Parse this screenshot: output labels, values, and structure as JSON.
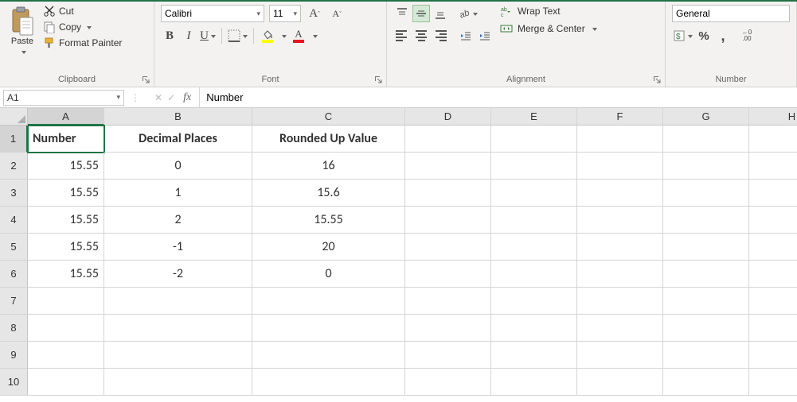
{
  "ribbon": {
    "clipboard": {
      "paste": "Paste",
      "cut": "Cut",
      "copy": "Copy",
      "format_painter": "Format Painter",
      "group_label": "Clipboard"
    },
    "font": {
      "name": "Calibri",
      "size": "11",
      "bold_glyph": "B",
      "italic_glyph": "I",
      "underline_glyph": "U",
      "increase_glyph": "A",
      "decrease_glyph": "A",
      "font_color_glyph": "A",
      "group_label": "Font"
    },
    "alignment": {
      "wrap_text": "Wrap Text",
      "merge_center": "Merge & Center",
      "group_label": "Alignment"
    },
    "number": {
      "format": "General",
      "percent_glyph": "%",
      "comma_glyph": ",",
      "inc_dec_glyph_top": "←0",
      "inc_dec_glyph_bot": ".00",
      "group_label": "Number"
    }
  },
  "formula_bar": {
    "active_cell": "A1",
    "fx_label": "fx",
    "value": "Number"
  },
  "grid": {
    "columns": [
      "A",
      "B",
      "C",
      "D",
      "E",
      "F",
      "G",
      "H"
    ],
    "col_widths": [
      "cA",
      "cB",
      "cC",
      "cD",
      "cE",
      "cF",
      "cG",
      "cH"
    ],
    "rows": [
      "1",
      "2",
      "3",
      "4",
      "5",
      "6",
      "7",
      "8",
      "9",
      "10"
    ],
    "selected_cell": "A1"
  },
  "chart_data": {
    "type": "table",
    "headers": [
      "Number",
      "Decimal Places",
      "Rounded Up Value"
    ],
    "rows": [
      [
        "15.55",
        "0",
        "16"
      ],
      [
        "15.55",
        "1",
        "15.6"
      ],
      [
        "15.55",
        "2",
        "15.55"
      ],
      [
        "15.55",
        "-1",
        "20"
      ],
      [
        "15.55",
        "-2",
        "0"
      ]
    ]
  }
}
